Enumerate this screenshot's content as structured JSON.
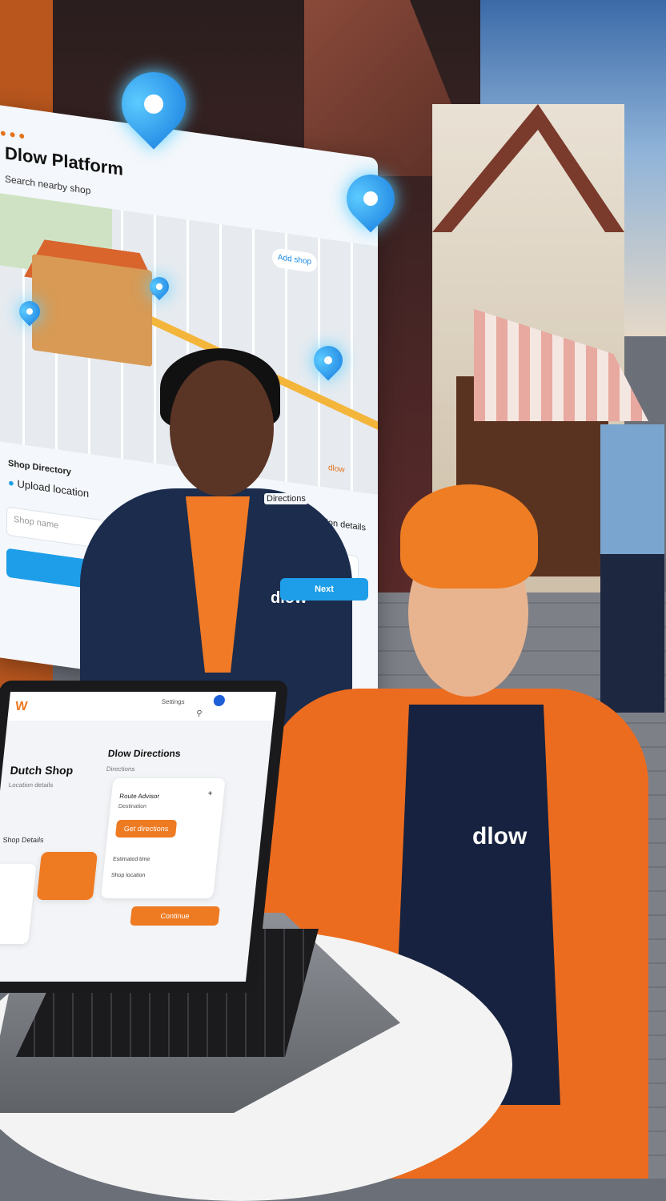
{
  "scene": {
    "description_colors": {
      "brand_orange": "#ee7a22",
      "navy": "#1b2c4d",
      "pin_blue": "#1e9ee8"
    }
  },
  "panel": {
    "title": "Dlow Platform",
    "subtitle": "Search nearby shop",
    "map_button": "Add shop",
    "section_left": "Shop Directory",
    "location_text": "Upload location",
    "section_right": "Directions",
    "section_right_sub": "Directions to location details",
    "input_placeholder": "Shop name",
    "primary_button": "C",
    "secondary_button": "Next",
    "map_label": "dlow"
  },
  "laptop": {
    "logo": "W",
    "nav_text": "Settings",
    "heading_left": "Dutch Shop",
    "sub_left": "Location details",
    "section_left": "Shop Details",
    "heading_right": "Dlow Directions",
    "sub_right": "Directions",
    "card_title": "Route Advisor",
    "card_sub": "Destination",
    "card_button": "Get directions",
    "row1": "Estimated time",
    "row2": "Shop location",
    "bottom_button": "Continue"
  },
  "uniforms": {
    "logo_1": "dlow",
    "logo_2": "dlow"
  },
  "icons": [
    "map-pin-icon",
    "search-icon",
    "plus-icon",
    "avatar-icon"
  ]
}
